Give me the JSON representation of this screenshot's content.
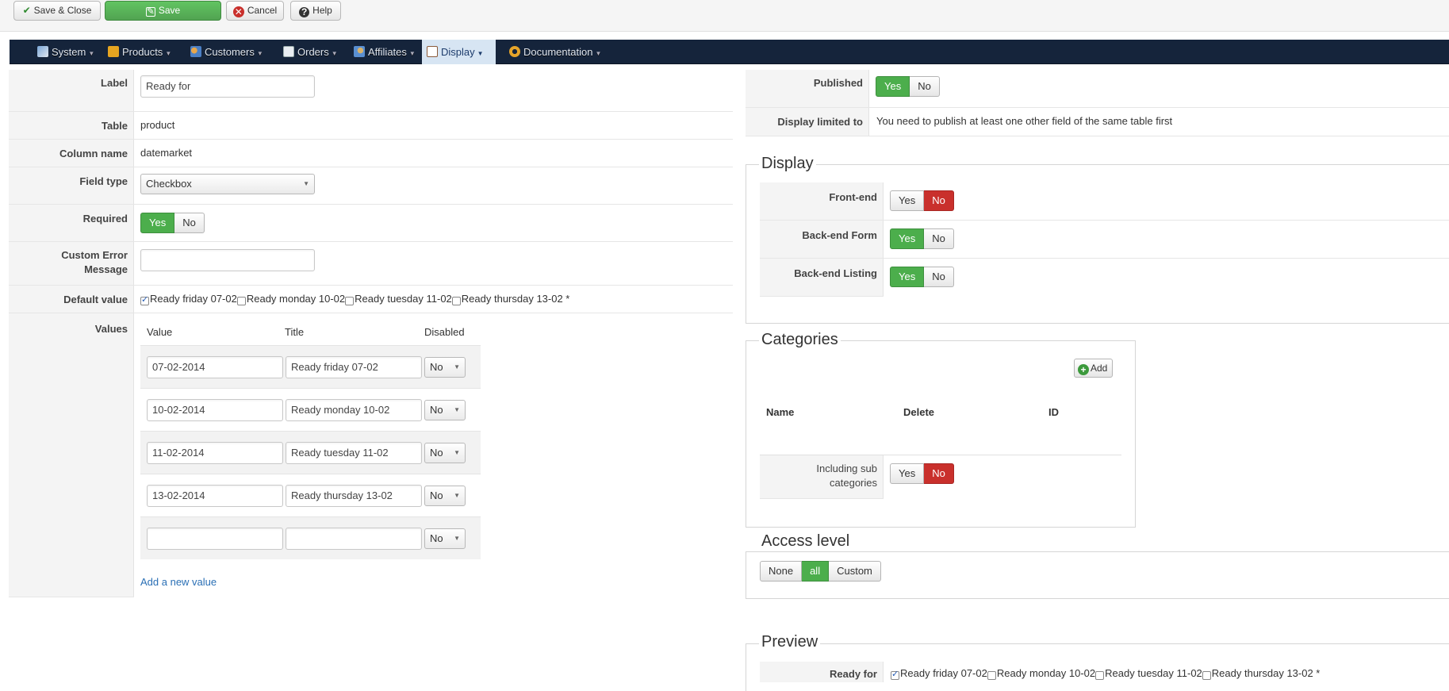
{
  "toolbar": {
    "save_close": "Save & Close",
    "save": "Save",
    "cancel": "Cancel",
    "help": "Help"
  },
  "nav": {
    "items": [
      {
        "label": "System",
        "icon": "tools-icon"
      },
      {
        "label": "Products",
        "icon": "products-icon"
      },
      {
        "label": "Customers",
        "icon": "customers-icon"
      },
      {
        "label": "Orders",
        "icon": "orders-icon"
      },
      {
        "label": "Affiliates",
        "icon": "affiliates-icon"
      },
      {
        "label": "Display",
        "icon": "display-icon",
        "active": true
      },
      {
        "label": "Documentation",
        "icon": "documentation-icon"
      }
    ]
  },
  "form": {
    "label": {
      "label": "Label",
      "value": "Ready for"
    },
    "table": {
      "label": "Table",
      "value": "product"
    },
    "column": {
      "label": "Column name",
      "value": "datemarket"
    },
    "field_type": {
      "label": "Field type",
      "value": "Checkbox"
    },
    "required": {
      "label": "Required",
      "yes": "Yes",
      "no": "No",
      "selected": "Yes"
    },
    "custom_error": {
      "label_line1": "Custom Error",
      "label_line2": "Message",
      "value": ""
    },
    "default_value": {
      "label": "Default value",
      "options": [
        {
          "text": "Ready friday 07-02",
          "checked": true
        },
        {
          "text": "Ready monday 10-02",
          "checked": false
        },
        {
          "text": "Ready tuesday 11-02",
          "checked": false
        },
        {
          "text": "Ready thursday 13-02 *",
          "checked": false
        }
      ]
    },
    "values": {
      "label": "Values",
      "headers": {
        "value": "Value",
        "title": "Title",
        "disabled": "Disabled"
      },
      "rows": [
        {
          "value": "07-02-2014",
          "title": "Ready friday 07-02",
          "disabled": "No"
        },
        {
          "value": "10-02-2014",
          "title": "Ready monday 10-02",
          "disabled": "No"
        },
        {
          "value": "11-02-2014",
          "title": "Ready tuesday 11-02",
          "disabled": "No"
        },
        {
          "value": "13-02-2014",
          "title": "Ready thursday 13-02",
          "disabled": "No"
        },
        {
          "value": "",
          "title": "",
          "disabled": "No"
        }
      ],
      "add_link": "Add a new value"
    }
  },
  "right": {
    "published": {
      "label": "Published",
      "yes": "Yes",
      "no": "No",
      "selected": "Yes"
    },
    "display_limited": {
      "label": "Display limited to",
      "value": "You need to publish at least one other field of the same table first"
    },
    "display": {
      "legend": "Display",
      "frontend": {
        "label": "Front-end",
        "yes": "Yes",
        "no": "No",
        "selected": "No"
      },
      "backend_form": {
        "label": "Back-end Form",
        "yes": "Yes",
        "no": "No",
        "selected": "Yes"
      },
      "backend_listing": {
        "label": "Back-end Listing",
        "yes": "Yes",
        "no": "No",
        "selected": "Yes"
      }
    },
    "categories": {
      "legend": "Categories",
      "add": "Add",
      "headers": {
        "name": "Name",
        "delete": "Delete",
        "id": "ID"
      },
      "including": {
        "label_line1": "Including sub",
        "label_line2": "categories",
        "yes": "Yes",
        "no": "No",
        "selected": "No"
      }
    },
    "access": {
      "legend": "Access level",
      "none": "None",
      "all": "all",
      "custom": "Custom",
      "selected": "all"
    },
    "preview": {
      "legend": "Preview",
      "label": "Ready for",
      "options": [
        {
          "text": "Ready friday 07-02",
          "checked": true
        },
        {
          "text": "Ready monday 10-02",
          "checked": false
        },
        {
          "text": "Ready tuesday 11-02",
          "checked": false
        },
        {
          "text": "Ready thursday 13-02 *",
          "checked": false
        }
      ]
    }
  },
  "colors": {
    "nav_bg": "#15243b",
    "green": "#4cae4c",
    "red": "#c9302c",
    "link": "#2a6fb5"
  }
}
